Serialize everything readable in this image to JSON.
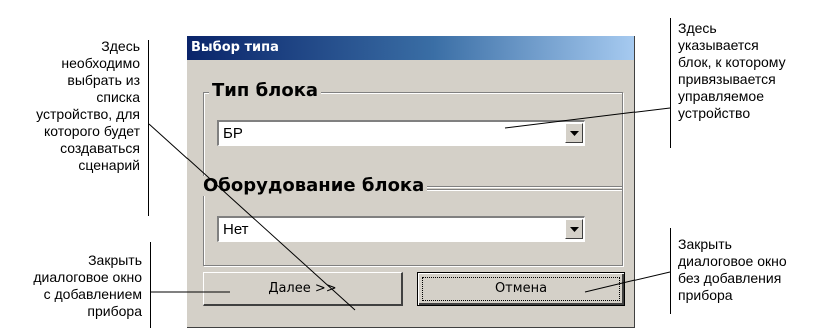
{
  "dialog": {
    "title": "Выбор типа",
    "group_block_type": {
      "legend": "Тип блока",
      "selected_value": "БР"
    },
    "group_equipment": {
      "legend": "Оборудование блока",
      "selected_value": "Нет"
    },
    "buttons": {
      "next_label": "Далее >>",
      "cancel_label": "Отмена"
    }
  },
  "annotations": {
    "left_top": [
      "Здесь",
      "необходимо",
      "выбрать из",
      "списка",
      "устройство, для",
      "которого будет",
      "создаваться",
      "сценарий"
    ],
    "left_bottom": [
      "Закрыть",
      "диалоговое окно",
      "с добавлением",
      "прибора"
    ],
    "right_top": [
      "Здесь",
      "указывается",
      "блок, к которому",
      "привязывается",
      "управляемое",
      "устройство"
    ],
    "right_bottom": [
      "Закрыть",
      "диалоговое окно",
      "без добавления",
      "прибора"
    ]
  },
  "icons": {
    "dropdown": "chevron-down-icon"
  }
}
